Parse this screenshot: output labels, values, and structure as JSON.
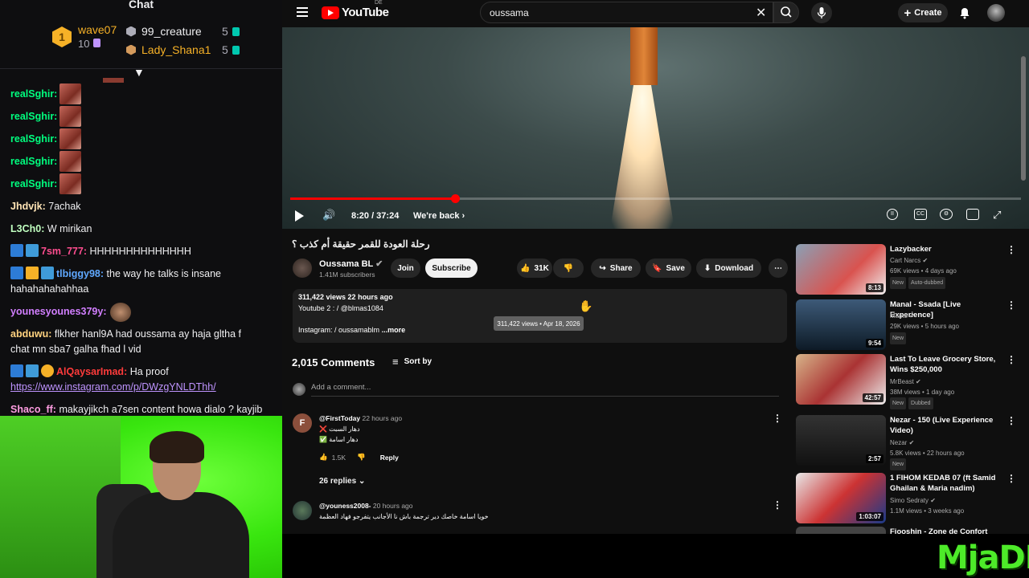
{
  "chat": {
    "title": "Chat",
    "leaderboard": [
      {
        "rank": "1",
        "name": "wave07",
        "count": "10"
      },
      {
        "name": "99_creature",
        "count": "5"
      },
      {
        "name": "Lady_Shana1",
        "count": "5"
      }
    ],
    "messages": [
      {
        "user": "realSghir:",
        "color": "#00ff7f"
      },
      {
        "user": "realSghir:",
        "color": "#00ff7f"
      },
      {
        "user": "realSghir:",
        "color": "#00ff7f"
      },
      {
        "user": "realSghir:",
        "color": "#00ff7f"
      },
      {
        "user": "realSghir:",
        "color": "#00ff7f"
      },
      {
        "user": "Jhdvjk:",
        "text": "7achak",
        "color": "#ffe4b5"
      },
      {
        "user": "L3Ch0:",
        "text": "W mirikan",
        "color": "#c0ffc0"
      },
      {
        "user": "7sm_777:",
        "text": "HHHHHHHHHHHHHH",
        "color": "#ff4d8f"
      },
      {
        "user": "tlbiggy98:",
        "text": "the way he talks is insane",
        "text2": "hahahahahahhaa",
        "color": "#5fa8ff"
      },
      {
        "user": "younesyounes379y:",
        "color": "#d27fff"
      },
      {
        "user": "abduwu:",
        "text": "flkher hanl9A had oussama ay haja gltha f",
        "text2": "chat mn sba7 galha fhad l vid",
        "color": "#ffd27f"
      },
      {
        "user": "AlQaysarImad:",
        "text": "Ha proof",
        "link": "https://www.instagram.com/p/DWzgYNLDThh/",
        "color": "#ff3b3b"
      },
      {
        "user": "Shaco_ff:",
        "text": "makayjikch a7sen content howa dialo ? kayjib",
        "color": "#ff9de2"
      }
    ]
  },
  "yt": {
    "logo": "YouTube",
    "country": "DE",
    "search_value": "oussama",
    "create_label": "Create",
    "player": {
      "progress_fraction": 0.226,
      "time": "8:20 / 37:24",
      "chapter": "We're back"
    },
    "video": {
      "title": "رحلة العودة للقمر حقيقة أم كذب ؟",
      "channel": "Oussama BL",
      "subs": "1.41M subscribers",
      "join": "Join",
      "subscribe": "Subscribe",
      "likes": "31K",
      "share": "Share",
      "save": "Save",
      "download": "Download"
    },
    "description": {
      "meta": "311,422 views  22 hours ago",
      "yt2": "Youtube 2 :  / @blmas1084",
      "ig": "Instagram:  / oussamablm",
      "more": "...more",
      "tooltip": "311,422 views • Apr 18, 2026"
    },
    "comments": {
      "count": "2,015 Comments",
      "sort": "Sort by",
      "add_placeholder": "Add a comment...",
      "items": [
        {
          "initial": "F",
          "author": "@FirstToday",
          "time": "22 hours ago",
          "line1": "❌ دهار السبت",
          "line2": "✅ دهار اسامة",
          "likes": "1.5K",
          "reply": "Reply",
          "replies": "26 replies"
        },
        {
          "author": "@youness2008-",
          "time": "20 hours ago",
          "line1": "خويا اسامة خاصك دير ترجمة باش نا الأجانب يتفرجو فهاد العظمة"
        }
      ]
    },
    "recs": [
      {
        "title": "Lazybacker",
        "channel": "Cart Narcs",
        "meta": "69K views • 4 days ago",
        "tags": [
          "New",
          "Auto-dubbed"
        ],
        "duration": "8:13",
        "thumb": "linear-gradient(135deg,#8aa0b5,#d9534f 60%,#f0f0f0)"
      },
      {
        "title": "Manal - Ssada [Live Experience]",
        "channel": "Manal",
        "meta": "29K views • 5 hours ago",
        "tags": [
          "New"
        ],
        "duration": "9:54",
        "thumb": "linear-gradient(180deg,#3d5a78,#0d1a26)"
      },
      {
        "title": "Last To Leave Grocery Store, Wins $250,000",
        "channel": "MrBeast",
        "meta": "38M views • 1 day ago",
        "tags": [
          "New",
          "Dubbed"
        ],
        "duration": "42:57",
        "thumb": "linear-gradient(135deg,#d7b48a,#a33,#eee)"
      },
      {
        "title": "Nezar - 150 (Live Experience Video)",
        "channel": "Nezar",
        "meta": "5.8K views • 22 hours ago",
        "tags": [
          "New"
        ],
        "duration": "2:57",
        "thumb": "linear-gradient(180deg,#333,#111)"
      },
      {
        "title": "1 FIHOM KEDAB 07 (ft Samid Ghailan & Maria nadim)",
        "channel": "Simo Sedraty",
        "meta": "1.1M views • 3 weeks ago",
        "tags": [],
        "duration": "1:03:07",
        "thumb": "linear-gradient(135deg,#e8e8e8,#c33 50%,#1a3a8a)"
      }
    ],
    "rec6_partial": "Fiooshin - Zone de Confort"
  },
  "watermark": "MjaDDD"
}
